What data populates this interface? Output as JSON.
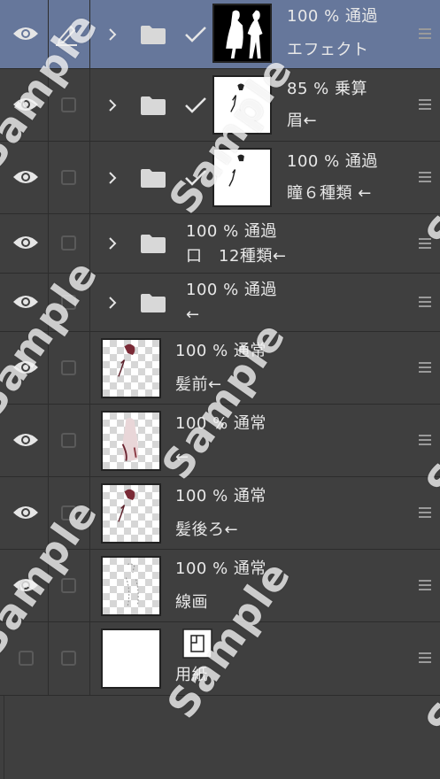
{
  "layers": [
    {
      "opacity": "100 %",
      "blend": "通過",
      "name": "エフェクト",
      "type": "folder",
      "selected": true
    },
    {
      "opacity": "85 %",
      "blend": "乗算",
      "name": "眉←",
      "type": "folder",
      "selected": false
    },
    {
      "opacity": "100 %",
      "blend": "通過",
      "name": "瞳６種類 ←",
      "type": "folder",
      "selected": false
    },
    {
      "opacity": "100 %",
      "blend": "通過",
      "name": "口　12種類←",
      "type": "folder",
      "selected": false
    },
    {
      "opacity": "100 %",
      "blend": "通過",
      "name": "←",
      "type": "folder",
      "selected": false
    },
    {
      "opacity": "100 %",
      "blend": "通常",
      "name": "髪前←",
      "type": "raster",
      "selected": false
    },
    {
      "opacity": "100 %",
      "blend": "通常",
      "name": "←",
      "type": "raster",
      "selected": false
    },
    {
      "opacity": "100 %",
      "blend": "通常",
      "name": "髪後ろ←",
      "type": "raster",
      "selected": false
    },
    {
      "opacity": "100 %",
      "blend": "通常",
      "name": "線画",
      "type": "raster",
      "selected": false
    },
    {
      "opacity": "",
      "blend": "",
      "name": "用紙",
      "type": "paper",
      "selected": false
    }
  ],
  "watermark": "Sample",
  "colors": {
    "panel": "#3f3f3f",
    "selected": "#66779b",
    "text": "#e8e8e8"
  }
}
